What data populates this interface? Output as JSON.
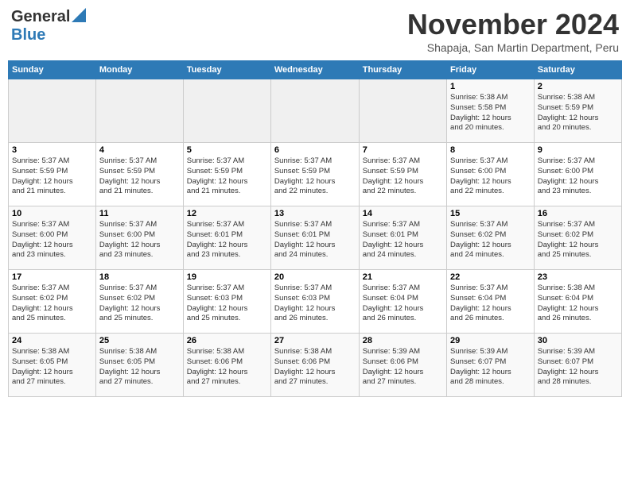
{
  "header": {
    "logo_general": "General",
    "logo_blue": "Blue",
    "month_title": "November 2024",
    "subtitle": "Shapaja, San Martin Department, Peru"
  },
  "calendar": {
    "days_of_week": [
      "Sunday",
      "Monday",
      "Tuesday",
      "Wednesday",
      "Thursday",
      "Friday",
      "Saturday"
    ],
    "weeks": [
      [
        {
          "day": "",
          "detail": ""
        },
        {
          "day": "",
          "detail": ""
        },
        {
          "day": "",
          "detail": ""
        },
        {
          "day": "",
          "detail": ""
        },
        {
          "day": "",
          "detail": ""
        },
        {
          "day": "1",
          "detail": "Sunrise: 5:38 AM\nSunset: 5:58 PM\nDaylight: 12 hours\nand 20 minutes."
        },
        {
          "day": "2",
          "detail": "Sunrise: 5:38 AM\nSunset: 5:59 PM\nDaylight: 12 hours\nand 20 minutes."
        }
      ],
      [
        {
          "day": "3",
          "detail": "Sunrise: 5:37 AM\nSunset: 5:59 PM\nDaylight: 12 hours\nand 21 minutes."
        },
        {
          "day": "4",
          "detail": "Sunrise: 5:37 AM\nSunset: 5:59 PM\nDaylight: 12 hours\nand 21 minutes."
        },
        {
          "day": "5",
          "detail": "Sunrise: 5:37 AM\nSunset: 5:59 PM\nDaylight: 12 hours\nand 21 minutes."
        },
        {
          "day": "6",
          "detail": "Sunrise: 5:37 AM\nSunset: 5:59 PM\nDaylight: 12 hours\nand 22 minutes."
        },
        {
          "day": "7",
          "detail": "Sunrise: 5:37 AM\nSunset: 5:59 PM\nDaylight: 12 hours\nand 22 minutes."
        },
        {
          "day": "8",
          "detail": "Sunrise: 5:37 AM\nSunset: 6:00 PM\nDaylight: 12 hours\nand 22 minutes."
        },
        {
          "day": "9",
          "detail": "Sunrise: 5:37 AM\nSunset: 6:00 PM\nDaylight: 12 hours\nand 23 minutes."
        }
      ],
      [
        {
          "day": "10",
          "detail": "Sunrise: 5:37 AM\nSunset: 6:00 PM\nDaylight: 12 hours\nand 23 minutes."
        },
        {
          "day": "11",
          "detail": "Sunrise: 5:37 AM\nSunset: 6:00 PM\nDaylight: 12 hours\nand 23 minutes."
        },
        {
          "day": "12",
          "detail": "Sunrise: 5:37 AM\nSunset: 6:01 PM\nDaylight: 12 hours\nand 23 minutes."
        },
        {
          "day": "13",
          "detail": "Sunrise: 5:37 AM\nSunset: 6:01 PM\nDaylight: 12 hours\nand 24 minutes."
        },
        {
          "day": "14",
          "detail": "Sunrise: 5:37 AM\nSunset: 6:01 PM\nDaylight: 12 hours\nand 24 minutes."
        },
        {
          "day": "15",
          "detail": "Sunrise: 5:37 AM\nSunset: 6:02 PM\nDaylight: 12 hours\nand 24 minutes."
        },
        {
          "day": "16",
          "detail": "Sunrise: 5:37 AM\nSunset: 6:02 PM\nDaylight: 12 hours\nand 25 minutes."
        }
      ],
      [
        {
          "day": "17",
          "detail": "Sunrise: 5:37 AM\nSunset: 6:02 PM\nDaylight: 12 hours\nand 25 minutes."
        },
        {
          "day": "18",
          "detail": "Sunrise: 5:37 AM\nSunset: 6:02 PM\nDaylight: 12 hours\nand 25 minutes."
        },
        {
          "day": "19",
          "detail": "Sunrise: 5:37 AM\nSunset: 6:03 PM\nDaylight: 12 hours\nand 25 minutes."
        },
        {
          "day": "20",
          "detail": "Sunrise: 5:37 AM\nSunset: 6:03 PM\nDaylight: 12 hours\nand 26 minutes."
        },
        {
          "day": "21",
          "detail": "Sunrise: 5:37 AM\nSunset: 6:04 PM\nDaylight: 12 hours\nand 26 minutes."
        },
        {
          "day": "22",
          "detail": "Sunrise: 5:37 AM\nSunset: 6:04 PM\nDaylight: 12 hours\nand 26 minutes."
        },
        {
          "day": "23",
          "detail": "Sunrise: 5:38 AM\nSunset: 6:04 PM\nDaylight: 12 hours\nand 26 minutes."
        }
      ],
      [
        {
          "day": "24",
          "detail": "Sunrise: 5:38 AM\nSunset: 6:05 PM\nDaylight: 12 hours\nand 27 minutes."
        },
        {
          "day": "25",
          "detail": "Sunrise: 5:38 AM\nSunset: 6:05 PM\nDaylight: 12 hours\nand 27 minutes."
        },
        {
          "day": "26",
          "detail": "Sunrise: 5:38 AM\nSunset: 6:06 PM\nDaylight: 12 hours\nand 27 minutes."
        },
        {
          "day": "27",
          "detail": "Sunrise: 5:38 AM\nSunset: 6:06 PM\nDaylight: 12 hours\nand 27 minutes."
        },
        {
          "day": "28",
          "detail": "Sunrise: 5:39 AM\nSunset: 6:06 PM\nDaylight: 12 hours\nand 27 minutes."
        },
        {
          "day": "29",
          "detail": "Sunrise: 5:39 AM\nSunset: 6:07 PM\nDaylight: 12 hours\nand 28 minutes."
        },
        {
          "day": "30",
          "detail": "Sunrise: 5:39 AM\nSunset: 6:07 PM\nDaylight: 12 hours\nand 28 minutes."
        }
      ]
    ]
  }
}
